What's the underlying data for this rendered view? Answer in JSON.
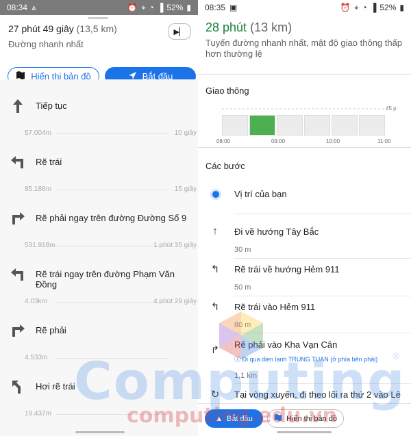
{
  "left": {
    "status": {
      "time": "08:34",
      "battery": "52%"
    },
    "header": {
      "time_main": "27 phút 49 giây",
      "time_sub": "(13,5 km)",
      "route_desc": "Đường nhanh nhất",
      "map_button": "Hiển thị bản đồ",
      "start_button": "Bắt đầu"
    },
    "steps": [
      {
        "icon": "straight-arrow-icon",
        "label": "Tiếp tục",
        "distance": "57.004m",
        "duration": "10 giây"
      },
      {
        "icon": "turn-left-icon",
        "label": "Rẽ trái",
        "distance": "85.188m",
        "duration": "15 giây"
      },
      {
        "icon": "turn-right-icon",
        "label": "Rẽ phải ngay trên đường Đường Số 9",
        "distance": "531.918m",
        "duration": "1 phút 35 giây"
      },
      {
        "icon": "turn-left-icon",
        "label": "Rẽ trái ngay trên đường Phạm Văn Đồng",
        "distance": "4.03km",
        "duration": "4 phút 29 giây"
      },
      {
        "icon": "turn-right-icon",
        "label": "Rẽ phải",
        "distance": "4.533m",
        "duration": ""
      },
      {
        "icon": "slight-left-icon",
        "label": "Hơi rẽ trái",
        "distance": "19.437m",
        "duration": ""
      }
    ]
  },
  "right": {
    "status": {
      "time": "08:35",
      "battery": "52%"
    },
    "summary": {
      "time": "28 phút",
      "distance": "(13 km)",
      "desc": "Tuyến đường nhanh nhất, mật độ giao thông thấp hơn thường lệ"
    },
    "traffic": {
      "heading": "Giao thông",
      "max_label": "45 p",
      "ticks": [
        "08:00",
        "09:00",
        "10:00",
        "11:00"
      ]
    },
    "steps_heading": "Các bước",
    "steps": [
      {
        "icon": "location-dot-icon",
        "label": "Vị trí của bạn",
        "note": "",
        "distance": ""
      },
      {
        "icon": "straight-arrow-icon",
        "label": "Đi về hướng Tây Bắc",
        "note": "",
        "distance": "30 m"
      },
      {
        "icon": "turn-left-icon",
        "label": "Rẽ trái về hướng Hẻm 911",
        "note": "",
        "distance": "50 m"
      },
      {
        "icon": "turn-left-icon",
        "label": "Rẽ trái vào Hẻm 911",
        "note": "",
        "distance": "80 m"
      },
      {
        "icon": "turn-right-icon",
        "label": "Rẽ phải vào Kha Vạn Cân",
        "note": "Đi qua dien lanh TRUNG TUAN (ở phía bên phải)",
        "distance": "1,1 km"
      },
      {
        "icon": "roundabout-icon",
        "label": "Tại vòng xuyến, đi theo lối ra thứ 2 vào Lê",
        "note": "",
        "distance": ""
      }
    ],
    "bottom": {
      "start_button": "Bắt đầu",
      "map_button": "Hiển thị bản đồ"
    }
  },
  "watermark": {
    "main": "Computing",
    "sub": "computing.edu.vn",
    "mark": "®"
  }
}
